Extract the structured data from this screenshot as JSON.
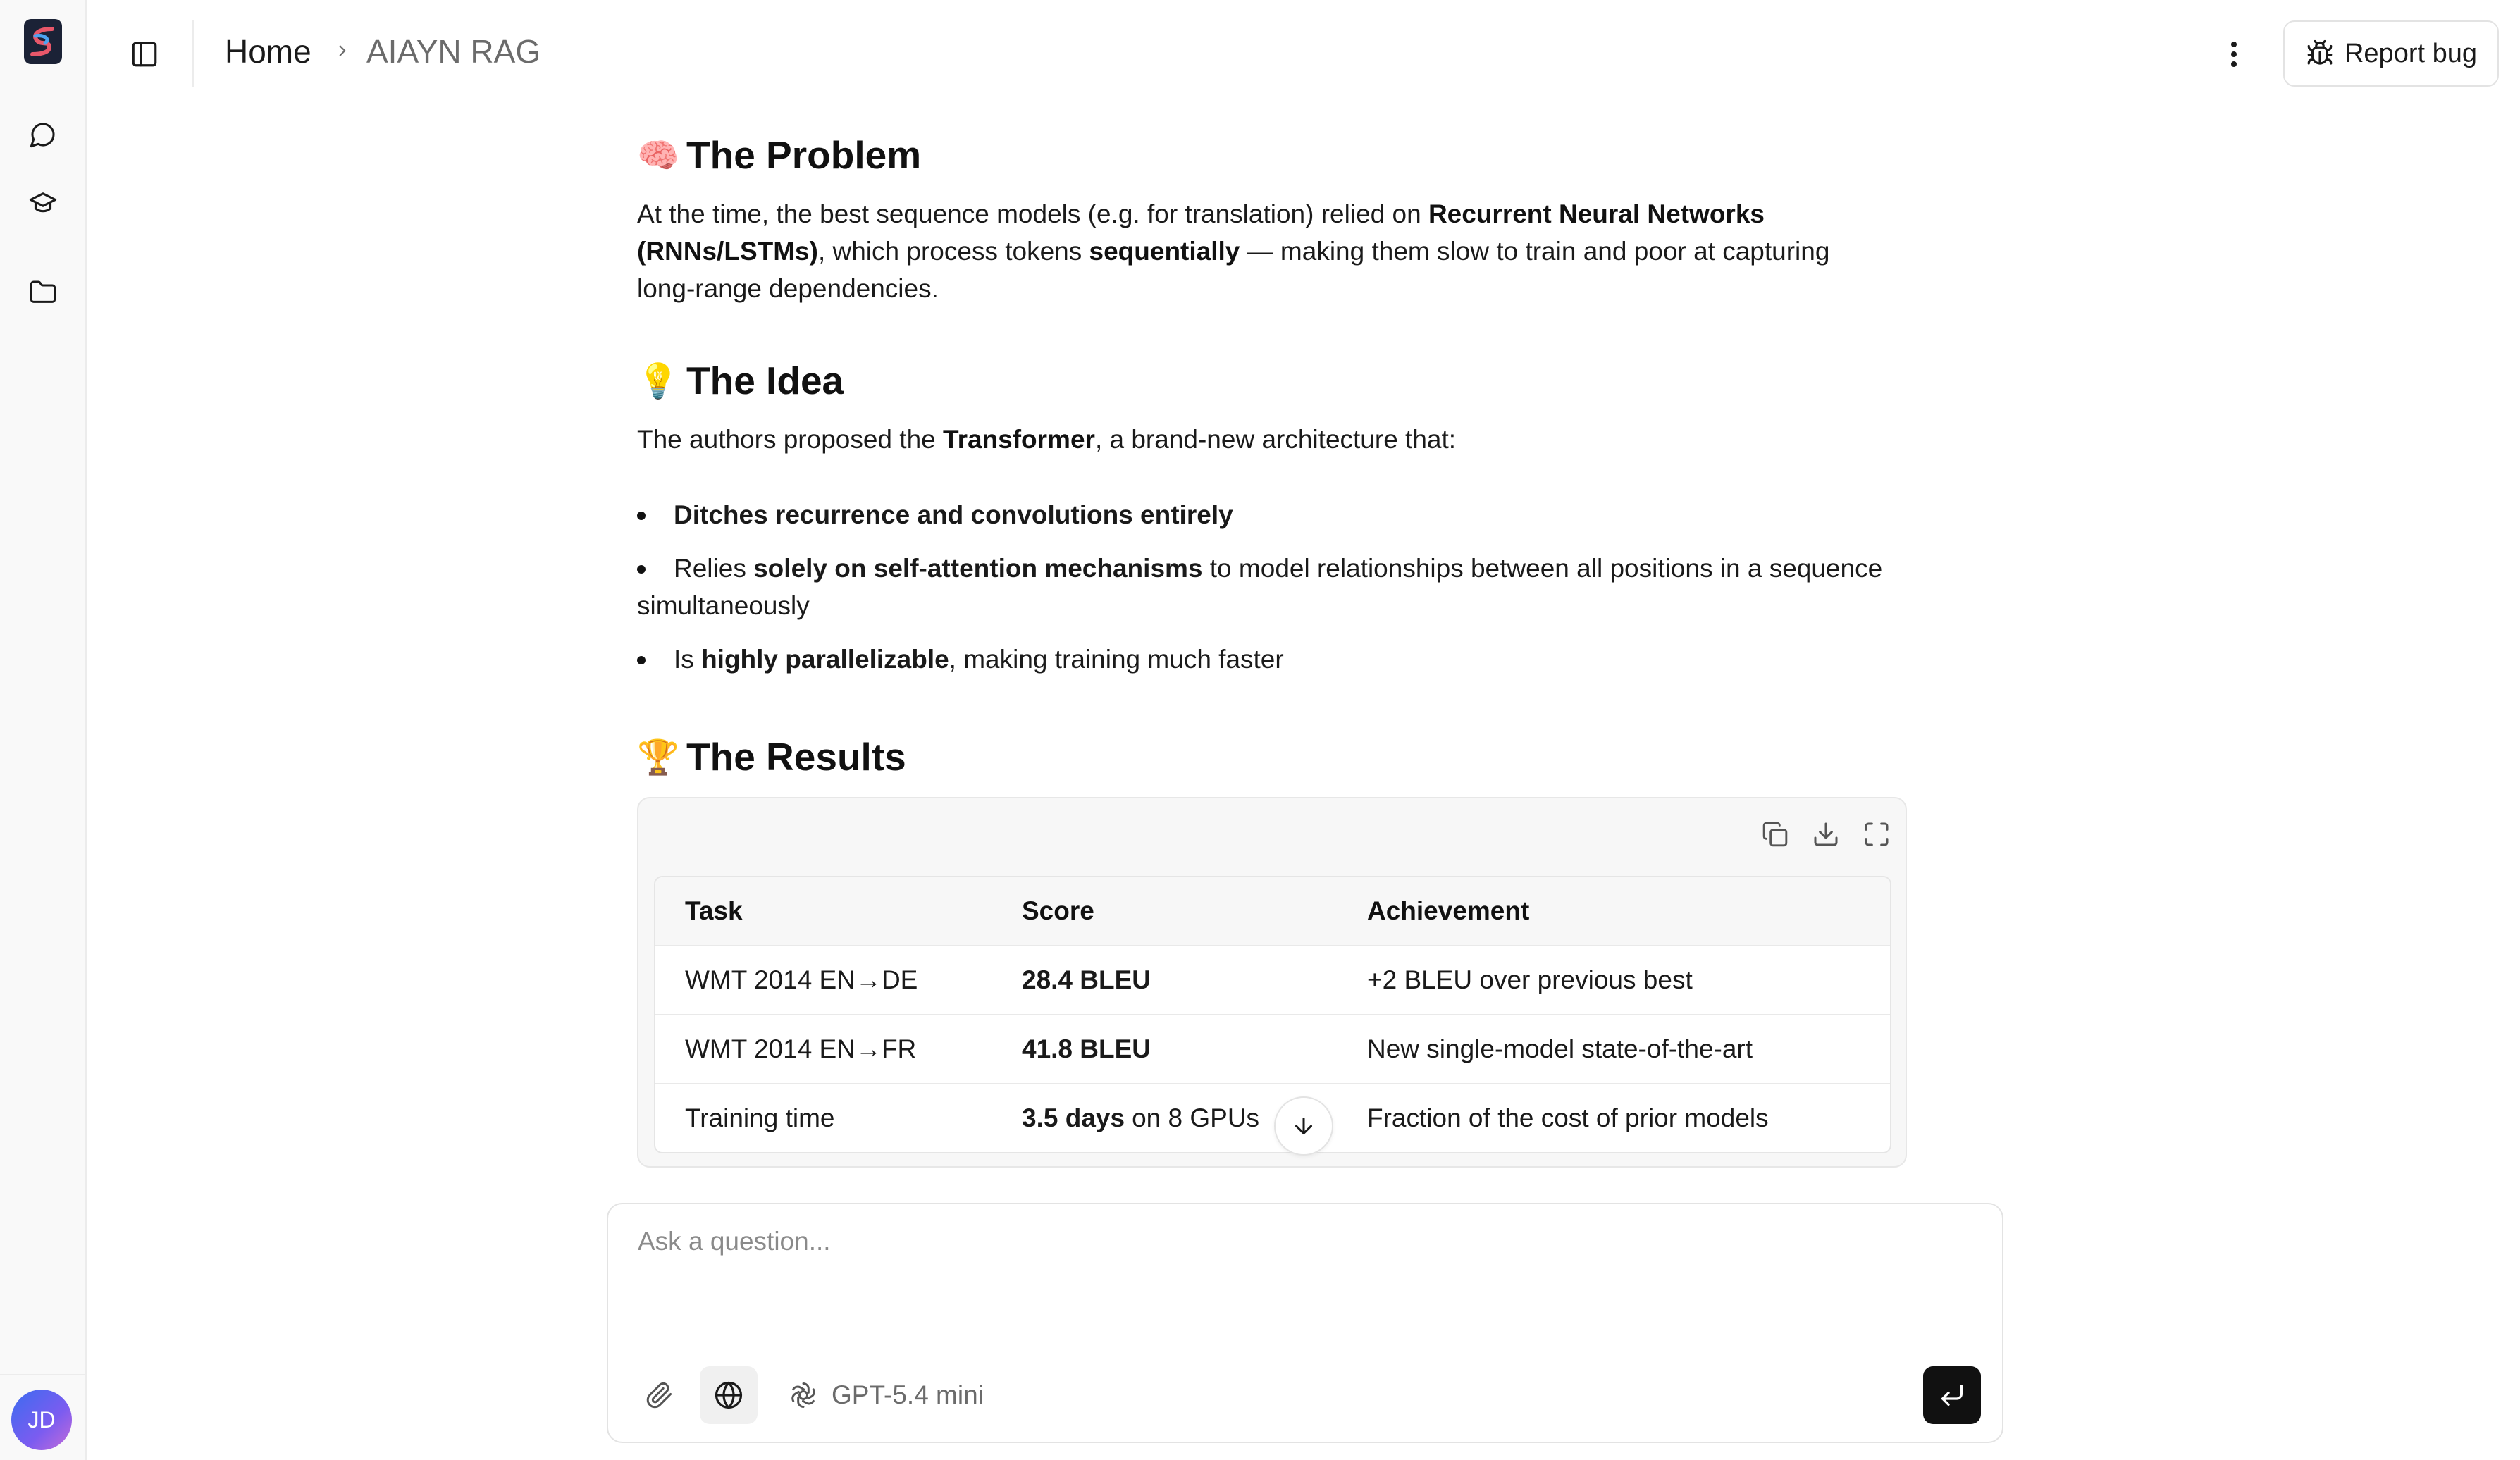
{
  "header": {
    "breadcrumb": {
      "home": "Home",
      "current": "AIAYN RAG"
    },
    "report_bug": "Report bug"
  },
  "sidebar": {
    "items": [
      {
        "icon": "chat-bubble-icon"
      },
      {
        "icon": "graduation-cap-icon"
      },
      {
        "icon": "folder-icon"
      }
    ],
    "avatar_initials": "JD"
  },
  "content": {
    "problem": {
      "emoji": "🧠",
      "title": "The Problem",
      "p1": "At the time, the best sequence models (e.g. for translation) relied on ",
      "b1": "Recurrent Neural Networks (RNNs/LSTMs)",
      "p2": ", which process tokens ",
      "b2": "sequentially",
      "p3": " — making them slow to train and poor at capturing long-range dependencies."
    },
    "idea": {
      "emoji": "💡",
      "title": "The Idea",
      "p1": "The authors proposed the ",
      "b1": "Transformer",
      "p2": ", a brand-new architecture that:",
      "bullets": [
        {
          "pre": "",
          "bold": "Ditches recurrence and convolutions entirely",
          "post": ""
        },
        {
          "pre": "Relies ",
          "bold": "solely on self-attention mechanisms",
          "post": " to model relationships between all positions in a sequence simultaneously"
        },
        {
          "pre": "Is ",
          "bold": "highly parallelizable",
          "post": ", making training much faster"
        }
      ]
    },
    "results": {
      "emoji": "🏆",
      "title": "The Results",
      "table": {
        "headers": [
          "Task",
          "Score",
          "Achievement"
        ],
        "rows": [
          {
            "task": "WMT 2014 EN→DE",
            "score_bold": "28.4 BLEU",
            "score_rest": "",
            "achievement": "+2 BLEU over previous best"
          },
          {
            "task": "WMT 2014 EN→FR",
            "score_bold": "41.8 BLEU",
            "score_rest": "",
            "achievement": "New single-model state-of-the-art"
          },
          {
            "task": "Training time",
            "score_bold": "3.5 days",
            "score_rest": "on 8 GPUs",
            "achievement": "Fraction of the cost of prior models"
          }
        ]
      }
    }
  },
  "composer": {
    "placeholder": "Ask a question...",
    "model": "GPT-5.4 mini"
  },
  "colors": {
    "accent": "#111111",
    "muted": "#6b6b6b",
    "sidebar_bg": "#f9f9f9"
  }
}
